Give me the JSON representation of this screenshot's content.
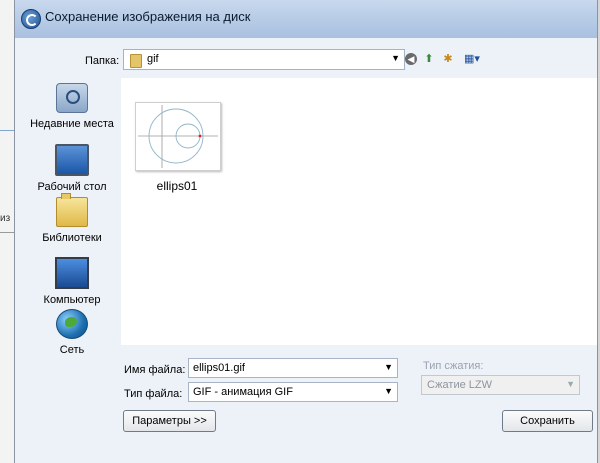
{
  "background": {
    "fragment_text": "из"
  },
  "dialog": {
    "title": "Сохранение изображения на диск"
  },
  "toolbar": {
    "folder_label": "Папка:",
    "folder_value": "gif",
    "back_icon": "back-icon",
    "up_icon": "up-folder-icon",
    "new_folder_icon": "new-folder-icon",
    "view_icon": "view-menu-icon"
  },
  "places": [
    {
      "label": "Недавние места",
      "icon": "recent-places-icon"
    },
    {
      "label": "Рабочий стол",
      "icon": "desktop-icon"
    },
    {
      "label": "Библиотеки",
      "icon": "libraries-icon"
    },
    {
      "label": "Компьютер",
      "icon": "computer-icon"
    },
    {
      "label": "Сеть",
      "icon": "network-icon"
    }
  ],
  "files": [
    {
      "name": "ellips01"
    }
  ],
  "form": {
    "filename_label": "Имя файла:",
    "filename_value": "ellips01.gif",
    "filetype_label": "Тип файла:",
    "filetype_value": "GIF - анимация GIF",
    "compression_label": "Тип сжатия:",
    "compression_value": "Сжатие LZW"
  },
  "buttons": {
    "params": "Параметры >>",
    "save": "Сохранить"
  },
  "colors": {
    "titlebar": "#b9cde7",
    "dialog_bg": "#edf2f8",
    "disabled_text": "#9aa3ae"
  }
}
